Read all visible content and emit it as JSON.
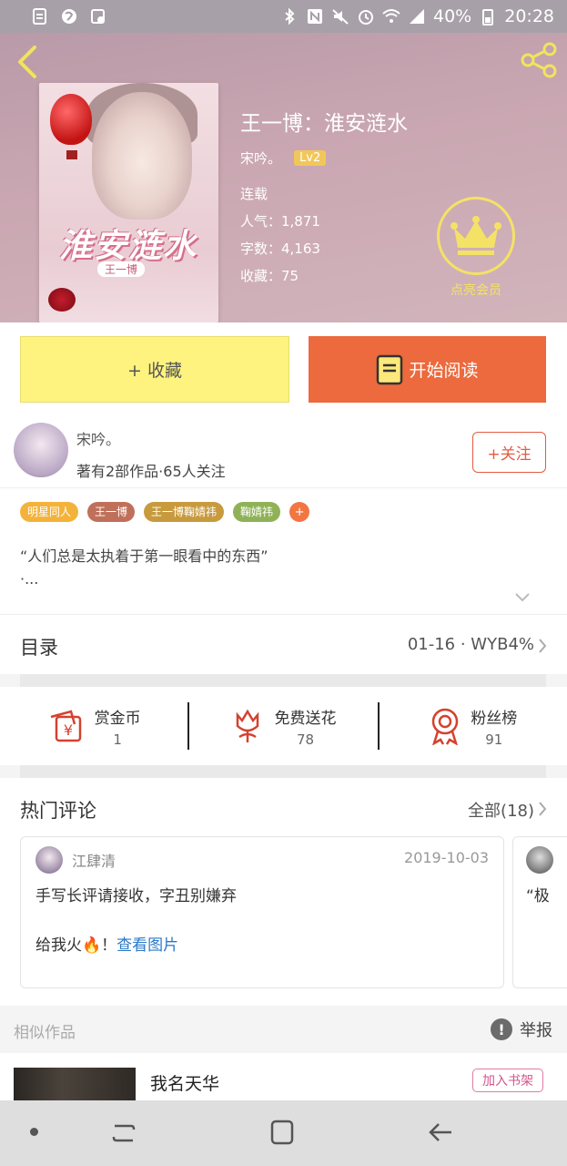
{
  "status_bar": {
    "battery": "40%",
    "time": "20:28",
    "network": "4G"
  },
  "book": {
    "title": "王一博：淮安涟水",
    "author": "宋吟。",
    "author_level": "Lv2",
    "status": "连载",
    "popularity": "人气：1,871",
    "word_count": "字数：4,163",
    "favorites": "收藏：75",
    "cover_title": "淮安涟水",
    "cover_subtitle": "王一博"
  },
  "vip": {
    "label": "点亮会员"
  },
  "actions": {
    "collect_label": "+ 收藏",
    "read_label": "开始阅读"
  },
  "author_card": {
    "name": "宋吟。",
    "stats": "著有2部作品·65人关注",
    "follow_label": "+关注"
  },
  "tags": [
    {
      "label": "明星同人",
      "color": "#f3b33b"
    },
    {
      "label": "王一博",
      "color": "#c0705a"
    },
    {
      "label": "王一博鞠婧祎",
      "color": "#c89a3e"
    },
    {
      "label": "鞠婧祎",
      "color": "#8fb256"
    }
  ],
  "tag_more": "+",
  "intro": {
    "line1": "“人们总是太执着于第一眼看中的东西”",
    "line2": "·..."
  },
  "toc": {
    "label": "目录",
    "latest": "01-16 · WYB4%"
  },
  "rewards": [
    {
      "label": "赏金币",
      "count": "1"
    },
    {
      "label": "免费送花",
      "count": "78"
    },
    {
      "label": "粉丝榜",
      "count": "91"
    }
  ],
  "comments": {
    "title": "热门评论",
    "all_label": "全部(18)",
    "items": [
      {
        "user": "江肆清",
        "date": "2019-10-03",
        "line1": "手写长评请接收，字丑别嫌弃",
        "line2_prefix": "给我火🔥！",
        "line2_link": "查看图片"
      },
      {
        "text": "“极"
      }
    ]
  },
  "similar": {
    "label": "相似作品",
    "report_label": "举报",
    "items": [
      {
        "title": "我名天华",
        "button": "加入书架"
      }
    ]
  }
}
